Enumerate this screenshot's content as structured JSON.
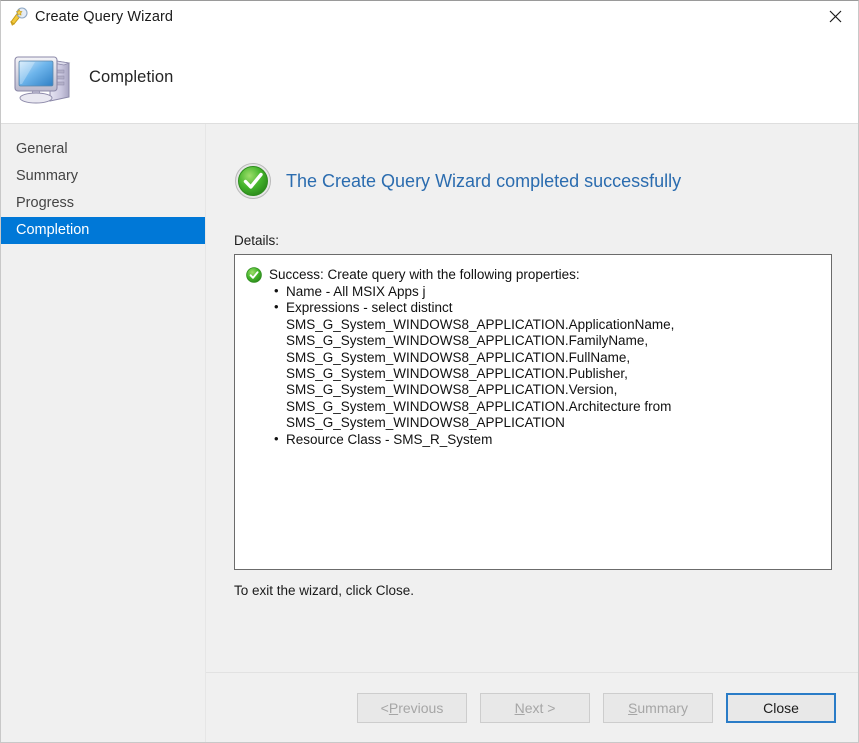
{
  "window": {
    "title": "Create Query Wizard",
    "title_icon": "wizard-wand-icon",
    "close_icon": "close-icon"
  },
  "header": {
    "title": "Completion",
    "icon": "computer-monitor-icon"
  },
  "sidebar": {
    "items": [
      {
        "label": "General",
        "selected": false
      },
      {
        "label": "Summary",
        "selected": false
      },
      {
        "label": "Progress",
        "selected": false
      },
      {
        "label": "Completion",
        "selected": true
      }
    ]
  },
  "main": {
    "success_icon": "green-check-circle-icon",
    "success_heading": "The Create Query Wizard completed successfully",
    "details_label": "Details:",
    "details": {
      "status_icon": "green-check-circle-icon",
      "status_text": "Success: Create query with the following properties:",
      "bullets": [
        {
          "text": "Name - All MSIX Apps j"
        },
        {
          "text": "Expressions - select distinct",
          "lines": [
            "SMS_G_System_WINDOWS8_APPLICATION.ApplicationName,",
            "SMS_G_System_WINDOWS8_APPLICATION.FamilyName,",
            "SMS_G_System_WINDOWS8_APPLICATION.FullName,",
            "SMS_G_System_WINDOWS8_APPLICATION.Publisher,",
            "SMS_G_System_WINDOWS8_APPLICATION.Version,",
            "SMS_G_System_WINDOWS8_APPLICATION.Architecture from",
            "SMS_G_System_WINDOWS8_APPLICATION"
          ]
        },
        {
          "text": "Resource Class - SMS_R_System"
        }
      ]
    },
    "exit_text": "To exit the wizard, click Close."
  },
  "footer": {
    "previous": {
      "label": "< Previous",
      "mnemonic": "P",
      "enabled": false
    },
    "next": {
      "label": "Next >",
      "mnemonic": "N",
      "enabled": false
    },
    "summary": {
      "label": "Summary",
      "mnemonic": "S",
      "enabled": false
    },
    "close": {
      "label": "Close",
      "enabled": true,
      "default": true
    }
  },
  "colors": {
    "accent": "#0078d7",
    "heading": "#2b6caf",
    "success_green": "#33a02c",
    "default_button_border": "#2a7cc7",
    "window_bg": "#f0f0f0"
  }
}
